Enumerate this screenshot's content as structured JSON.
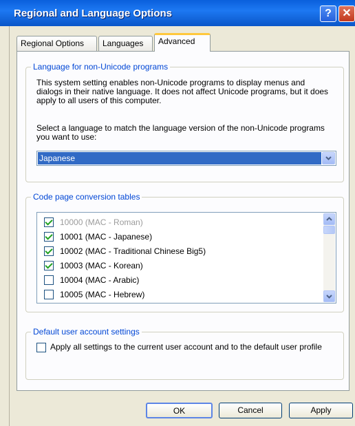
{
  "window": {
    "title": "Regional and Language Options",
    "help_glyph": "?",
    "close_glyph": "✕"
  },
  "tabs": [
    {
      "label": "Regional Options",
      "active": false
    },
    {
      "label": "Languages",
      "active": false
    },
    {
      "label": "Advanced",
      "active": true
    }
  ],
  "non_unicode": {
    "group_label": "Language for non-Unicode programs",
    "description": "This system setting enables non-Unicode programs to display menus and dialogs in their native language. It does not affect Unicode programs, but it does apply to all users of this computer.",
    "select_prompt": "Select a language to match the language version of the non-Unicode programs you want to use:",
    "selected_language": "Japanese"
  },
  "code_page": {
    "group_label": "Code page conversion tables",
    "items": [
      {
        "label": "10000 (MAC - Roman)",
        "checked": true,
        "disabled": true
      },
      {
        "label": "10001 (MAC - Japanese)",
        "checked": true,
        "disabled": false
      },
      {
        "label": "10002 (MAC - Traditional Chinese Big5)",
        "checked": true,
        "disabled": false
      },
      {
        "label": "10003 (MAC - Korean)",
        "checked": true,
        "disabled": false
      },
      {
        "label": "10004 (MAC - Arabic)",
        "checked": false,
        "disabled": false
      },
      {
        "label": "10005 (MAC - Hebrew)",
        "checked": false,
        "disabled": false
      }
    ]
  },
  "default_user": {
    "group_label": "Default user account settings",
    "apply_all_label": "Apply all settings to the current user account and to the default user profile",
    "checked": false
  },
  "buttons": {
    "ok": "OK",
    "cancel": "Cancel",
    "apply": "Apply"
  },
  "colors": {
    "titlebar": "#0a5fdc",
    "selection": "#316ac5",
    "group_label": "#0046d5",
    "check": "#21a121"
  }
}
